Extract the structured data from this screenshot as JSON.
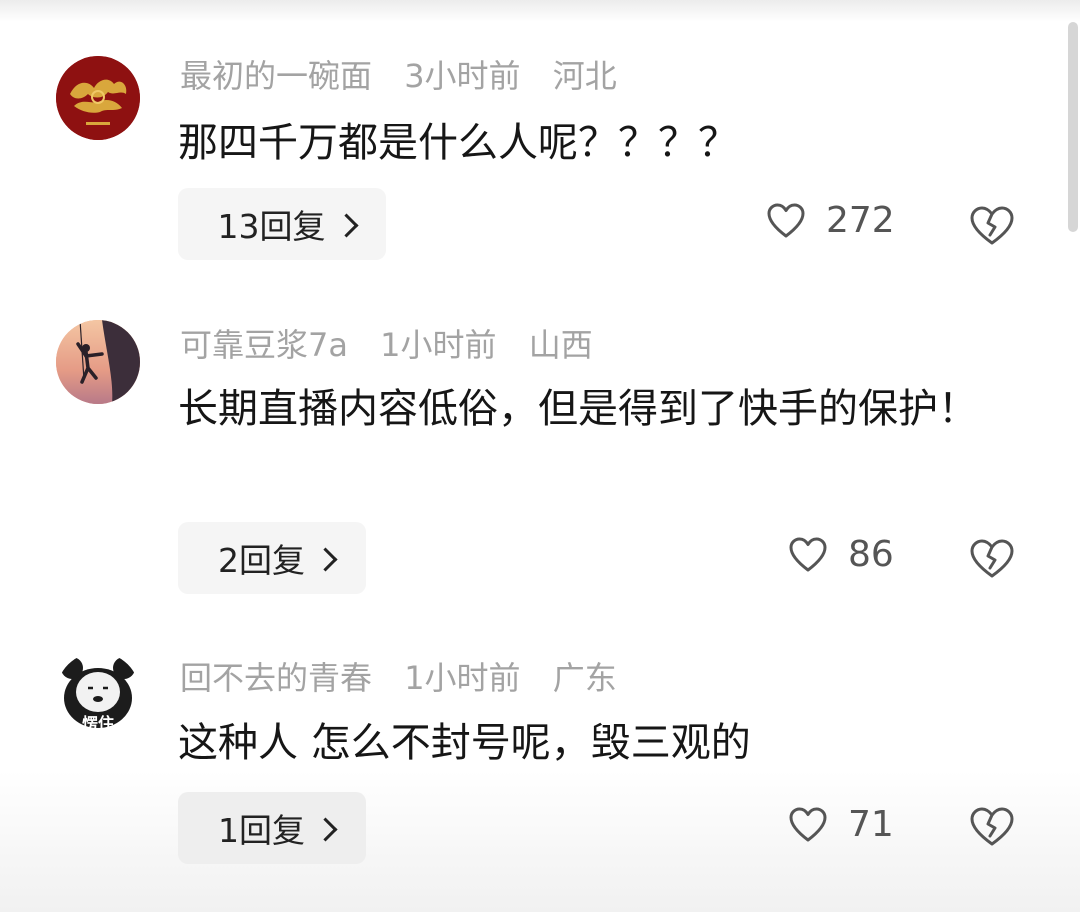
{
  "comments": [
    {
      "username": "最初的一碗面",
      "time": "3小时前",
      "location": "河北",
      "text": "那四千万都是什么人呢？？？？",
      "replies": "13回复",
      "likes": "272",
      "avatar": "red-seal-avatar"
    },
    {
      "username": "可靠豆浆7a",
      "time": "1小时前",
      "location": "山西",
      "text": "长期直播内容低俗，但是得到了快手的保护！",
      "replies": "2回复",
      "likes": "86",
      "avatar": "climber-sunset-avatar"
    },
    {
      "username": "回不去的青春",
      "time": "1小时前",
      "location": "广东",
      "text": "这种人 怎么不封号呢，毁三观的",
      "replies": "1回复",
      "likes": "71",
      "avatar": "panda-meme-avatar",
      "avatar_caption": "愣住"
    }
  ],
  "icons": {
    "like": "heart-outline-icon",
    "dislike": "broken-heart-icon",
    "reply_arrow": "chevron-right-icon"
  },
  "colors": {
    "meta": "#a3a3a3",
    "text": "#161616",
    "reply_bg": "#f5f5f5",
    "icon": "#555555"
  }
}
